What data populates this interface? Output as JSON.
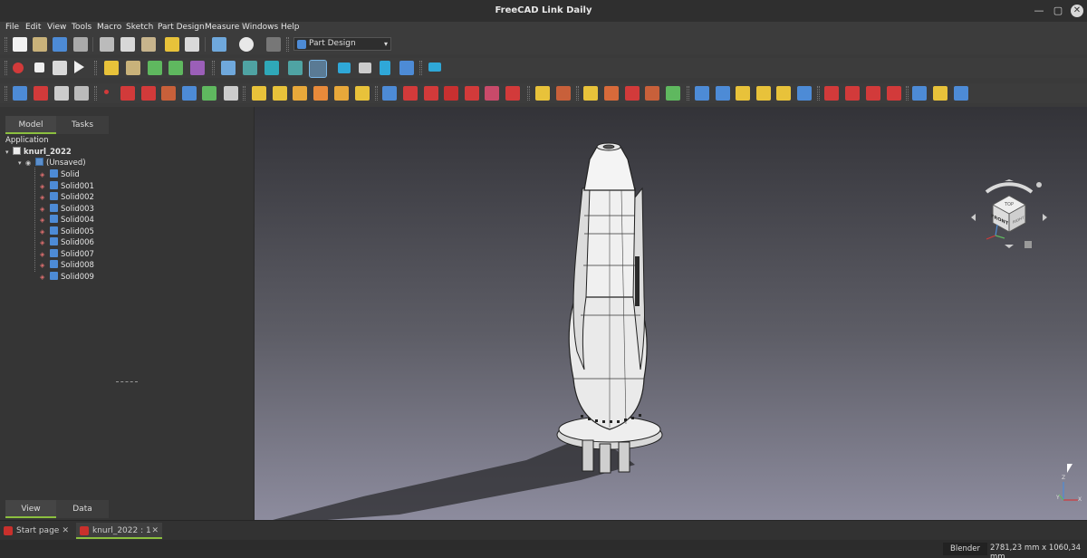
{
  "window": {
    "title": "FreeCAD Link Daily"
  },
  "menu": [
    "File",
    "Edit",
    "View",
    "Tools",
    "Macro",
    "Sketch",
    "Part Design",
    "Measure",
    "Windows",
    "Help"
  ],
  "workbench": {
    "selected": "Part Design"
  },
  "panel_tabs": {
    "model": "Model",
    "tasks": "Tasks"
  },
  "tree": {
    "root_label": "Application",
    "document": "knurl_2022",
    "body": "(Unsaved)",
    "solids": [
      "Solid",
      "Solid001",
      "Solid002",
      "Solid003",
      "Solid004",
      "Solid005",
      "Solid006",
      "Solid007",
      "Solid008",
      "Solid009"
    ]
  },
  "property_tabs": {
    "view": "View",
    "data": "Data"
  },
  "doc_tabs": [
    {
      "label": "Start page",
      "close": "✕"
    },
    {
      "label": "knurl_2022 : 1",
      "close": "✕"
    }
  ],
  "navcube": {
    "face_front": "FRONT",
    "face_top": "TOP",
    "face_right": "RIGHT"
  },
  "axes": {
    "x": "X",
    "y": "Y",
    "z": "Z"
  },
  "status": {
    "navigation_style": "Blender",
    "dimensions": "2781,23 mm x 1060,34 mm"
  },
  "colors": {
    "accent": "#8bbf3f",
    "selection": "#7ab6e6",
    "icon_blue": "#4d8bd6",
    "icon_yellow": "#e8c23a",
    "icon_red": "#d23a3a"
  },
  "icons": {
    "toolbar1": [
      "new-icon",
      "open-icon",
      "save-icon",
      "print-icon",
      "cut-icon",
      "copy-icon",
      "paste-icon",
      "undo-icon",
      "redo-icon",
      "refresh-check-icon",
      "recompute-icon",
      "whats-this-icon"
    ],
    "toolbar2": [
      "macro-record-icon",
      "macro-stop-icon",
      "macro-edit-icon",
      "macro-run-icon",
      "part-icon",
      "group-icon",
      "link-icon",
      "link-sub-icon",
      "link-select-icon",
      "fit-all-icon",
      "fit-selection-icon",
      "draw-style-icon",
      "bounding-box-icon",
      "std-view-icon",
      "nav-back-icon",
      "nav-forward-icon",
      "nav-up-icon",
      "nav-box-icon",
      "measure-icon"
    ],
    "toolbar3": [
      "body-icon",
      "sketch-icon",
      "validate-sketch-icon",
      "clone-icon",
      "datum-point-icon",
      "datum-line-icon",
      "datum-plane-icon",
      "lcs-icon",
      "shapebinder-icon",
      "subshape-binder-icon",
      "pad-icon",
      "revolve-icon",
      "loft-icon",
      "pipe-icon",
      "helix-icon",
      "additive-cube-icon",
      "pocket-icon",
      "hole-icon",
      "groove-icon",
      "subtractive-loft-icon",
      "subtractive-pipe-icon",
      "subtractive-cube-icon",
      "mirror-icon",
      "linear-pattern-icon",
      "polar-pattern-icon",
      "multitransform-icon",
      "fillet-icon",
      "chamfer-icon",
      "draft-icon",
      "thickness-icon",
      "boolean-icon"
    ]
  }
}
